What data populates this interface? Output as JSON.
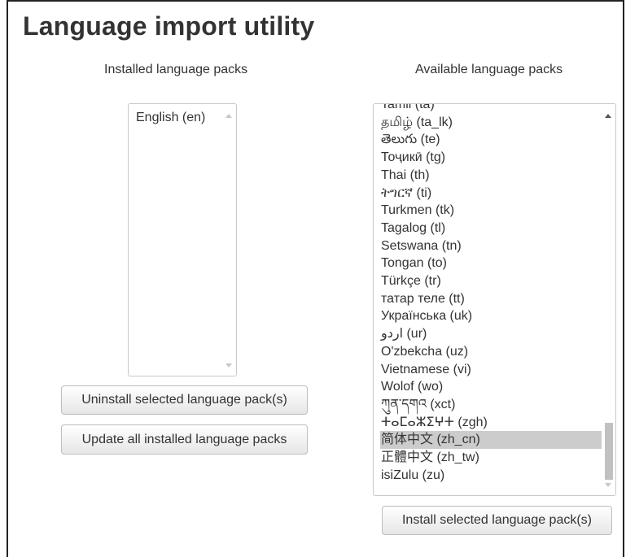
{
  "page": {
    "title": "Language import utility"
  },
  "installed": {
    "heading": "Installed language packs",
    "items": [
      {
        "label": "English (en)"
      }
    ],
    "uninstall_label": "Uninstall selected language pack(s)",
    "update_label": "Update all installed language packs"
  },
  "available": {
    "heading": "Available language packs",
    "items": [
      {
        "label": "Tamil (ta)"
      },
      {
        "label": "தமிழ் (ta_lk)"
      },
      {
        "label": "తెలుగు (te)"
      },
      {
        "label": "Тоҷикӣ (tg)"
      },
      {
        "label": "Thai (th)"
      },
      {
        "label": "ትግርኛ (ti)"
      },
      {
        "label": "Turkmen (tk)"
      },
      {
        "label": "Tagalog (tl)"
      },
      {
        "label": "Setswana (tn)"
      },
      {
        "label": "Tongan (to)"
      },
      {
        "label": "Türkçe (tr)"
      },
      {
        "label": "татар теле (tt)"
      },
      {
        "label": "Українська (uk)"
      },
      {
        "label": "اردو (ur)"
      },
      {
        "label": "O'zbekcha (uz)"
      },
      {
        "label": "Vietnamese (vi)"
      },
      {
        "label": "Wolof (wo)"
      },
      {
        "label": "ཀུན་དགའ (xct)"
      },
      {
        "label": "ⵜⴰⵎⴰⵣⵉⵖⵜ (zgh)"
      },
      {
        "label": "简体中文 (zh_cn)",
        "selected": true
      },
      {
        "label": "正體中文 (zh_tw)"
      },
      {
        "label": "isiZulu (zu)"
      }
    ],
    "install_label": "Install selected language pack(s)"
  }
}
